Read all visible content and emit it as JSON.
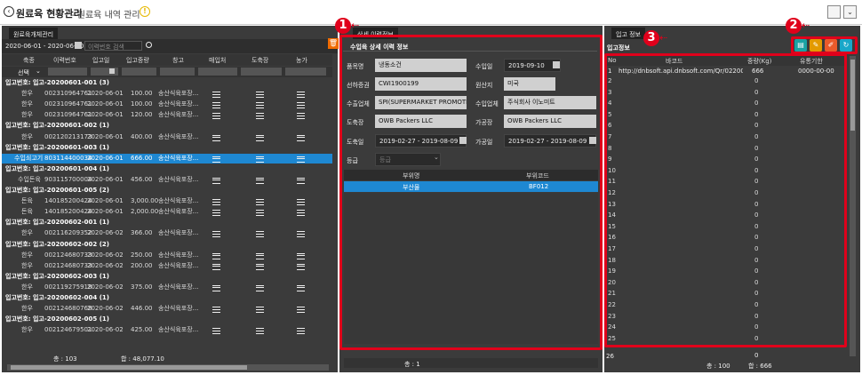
{
  "title": {
    "main": "원료육 현황관리",
    "sub": "- 원료육 내역 관리"
  },
  "left": {
    "tab": "원료육개체관리",
    "date_range": "2020-06-01 - 2020-06-30",
    "search_placeholder": "이력번호 검색",
    "columns": [
      "축종",
      "이력번호",
      "입고일",
      "입고중량",
      "창고",
      "매입처",
      "도축장",
      "농가"
    ],
    "select_label": "선택",
    "rows": [
      {
        "type": "group",
        "text": "입고번호: 입고-20200601-001 (3)"
      },
      {
        "type": "data",
        "c": [
          "한우",
          "002310964761",
          "2020-06-01",
          "100.00",
          "송산식육포장..."
        ]
      },
      {
        "type": "data",
        "c": [
          "한우",
          "002310964761",
          "2020-06-01",
          "100.00",
          "송산식육포장..."
        ]
      },
      {
        "type": "data",
        "c": [
          "한우",
          "002310964761",
          "2020-06-01",
          "120.00",
          "송산식육포장..."
        ]
      },
      {
        "type": "group",
        "text": "입고번호: 입고-20200601-002 (1)"
      },
      {
        "type": "data",
        "c": [
          "한우",
          "002120213173",
          "2020-06-01",
          "400.00",
          "송산식육포장..."
        ]
      },
      {
        "type": "group",
        "text": "입고번호: 입고-20200601-003 (1)"
      },
      {
        "type": "sel",
        "c": [
          "수입쇠고기",
          "803114400034",
          "2020-06-01",
          "666.00",
          "송산식육포장..."
        ]
      },
      {
        "type": "group",
        "text": "입고번호: 입고-20200601-004 (1)"
      },
      {
        "type": "data",
        "c": [
          "수입돈육",
          "903115700004",
          "2020-06-01",
          "456.00",
          "송산식육포장..."
        ]
      },
      {
        "type": "group",
        "text": "입고번호: 입고-20200601-005 (2)"
      },
      {
        "type": "data",
        "c": [
          "돈육",
          "140185200424",
          "2020-06-01",
          "3,000.00",
          "송산식육포장..."
        ]
      },
      {
        "type": "data",
        "c": [
          "돈육",
          "140185200424",
          "2020-06-01",
          "2,000.00",
          "송산식육포장..."
        ]
      },
      {
        "type": "group",
        "text": "입고번호: 입고-20200602-001 (1)"
      },
      {
        "type": "data",
        "c": [
          "한우",
          "002116209352",
          "2020-06-02",
          "366.00",
          "송산식육포장..."
        ]
      },
      {
        "type": "group",
        "text": "입고번호: 입고-20200602-002 (2)"
      },
      {
        "type": "data",
        "c": [
          "한우",
          "002124680733",
          "2020-06-02",
          "250.00",
          "송산식육포장..."
        ]
      },
      {
        "type": "data",
        "c": [
          "한우",
          "002124680733",
          "2020-06-02",
          "200.00",
          "송산식육포장..."
        ]
      },
      {
        "type": "group",
        "text": "입고번호: 입고-20200602-003 (1)"
      },
      {
        "type": "data",
        "c": [
          "한우",
          "002119275918",
          "2020-06-02",
          "375.00",
          "송산식육포장..."
        ]
      },
      {
        "type": "group",
        "text": "입고번호: 입고-20200602-004 (1)"
      },
      {
        "type": "data",
        "c": [
          "한우",
          "002124680768",
          "2020-06-02",
          "446.00",
          "송산식육포장..."
        ]
      },
      {
        "type": "group",
        "text": "입고번호: 입고-20200602-005 (1)"
      },
      {
        "type": "data",
        "c": [
          "한우",
          "002124679501",
          "2020-06-02",
          "425.00",
          "송산식육포장..."
        ]
      }
    ],
    "footer_total": "총 : 103",
    "footer_sum": "합 : 48,077.10"
  },
  "middle": {
    "tab": "상세 이력정보",
    "section_title": "수입육 상세 이력 정보",
    "fields": {
      "product_label": "품목명",
      "product": "냉동소건",
      "import_date_label": "수입일",
      "import_date": "2019-09-10",
      "cert_label": "선하증권",
      "cert": "CWI1900199",
      "origin_label": "원산지",
      "origin": "미국",
      "exporter_label": "수출업체",
      "exporter": "SPI(SUPERMARKET PROMOTIONS",
      "importer_label": "수입업체",
      "importer": "주식회사 이노미트",
      "slaughter_label": "도축장",
      "slaughter": "OWB Packers LLC",
      "processor_label": "가공장",
      "processor": "OWB Packers LLC",
      "slaughter_date_label": "도축일",
      "slaughter_date": "2019-02-27 - 2019-08-09",
      "process_date_label": "가공일",
      "process_date": "2019-02-27 - 2019-08-09",
      "grade_label": "등급",
      "grade": "등급"
    },
    "part_columns": [
      "부위명",
      "부위코드"
    ],
    "parts": [
      {
        "name": "부산물",
        "code": "BF012"
      }
    ],
    "footer": "총 : 1"
  },
  "right": {
    "tab": "입고 정보",
    "section_title": "입고정보",
    "columns": [
      "No",
      "바코드",
      "중량(Kg)",
      "유통기한"
    ],
    "first_row": {
      "no": "1",
      "barcode": "http://dnbsoft.api.dnbsoft.com/Qr/0220006115...",
      "weight": "666",
      "expiry": "0000-00-00"
    },
    "row_numbers": [
      "2",
      "3",
      "4",
      "5",
      "6",
      "7",
      "8",
      "9",
      "10",
      "11",
      "12",
      "13",
      "14",
      "15",
      "16",
      "17",
      "18",
      "19",
      "20",
      "21",
      "22",
      "23",
      "24",
      "25"
    ],
    "zero": "0",
    "last_no": "26",
    "footer_total": "총 : 100",
    "footer_sum": "합 : 666"
  },
  "annotations": {
    "badge1": "1",
    "badge2": "2",
    "badge3": "3"
  },
  "icons": {
    "back": "back-circle-icon",
    "info": "info-icon",
    "search": "search-icon",
    "calendar": "calendar-icon",
    "list": "list-icon"
  }
}
